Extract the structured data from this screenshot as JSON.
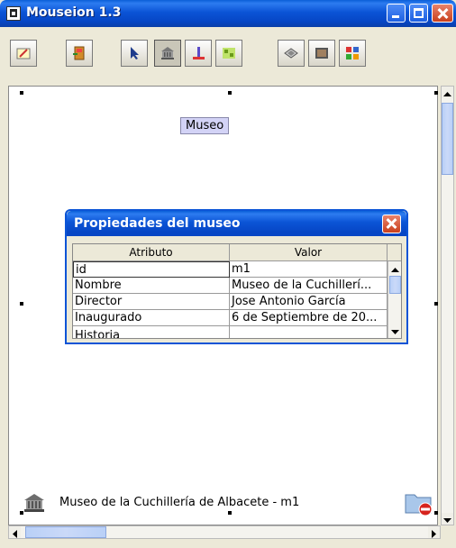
{
  "window": {
    "title": "Mouseion 1.3"
  },
  "toolbar": {
    "tools": [
      {
        "name": "edit-tool",
        "icon": "pencil-icon"
      },
      {
        "name": "exit-tool",
        "icon": "exit-door-icon"
      },
      {
        "name": "pointer-tool",
        "icon": "arrow-pointer-icon"
      },
      {
        "name": "museum-tool",
        "icon": "museum-building-icon"
      },
      {
        "name": "statue-tool",
        "icon": "statue-icon"
      },
      {
        "name": "map-tool",
        "icon": "floor-plan-icon"
      },
      {
        "name": "showcase-tool",
        "icon": "showcase-icon"
      },
      {
        "name": "painting-tool",
        "icon": "painting-icon"
      },
      {
        "name": "gallery-tool",
        "icon": "gallery-icon"
      }
    ]
  },
  "canvas": {
    "museo_label": "Museo"
  },
  "dialog": {
    "title": "Propiedades del museo",
    "columns": [
      "Atributo",
      "Valor"
    ],
    "rows": [
      {
        "atributo": "id",
        "valor": "m1"
      },
      {
        "atributo": "Nombre",
        "valor": "Museo de la Cuchillerí..."
      },
      {
        "atributo": "Director",
        "valor": "Jose Antonio García"
      },
      {
        "atributo": "Inaugurado",
        "valor": "6 de Septiembre de 20..."
      },
      {
        "atributo": "Historia",
        "valor": ""
      }
    ]
  },
  "statusbar": {
    "text": "Museo de la Cuchillería de Albacete - m1"
  },
  "colors": {
    "titlebar": "#0b54d6",
    "selection_label_bg": "#d3d3f6",
    "close_button": "#c9401d"
  }
}
